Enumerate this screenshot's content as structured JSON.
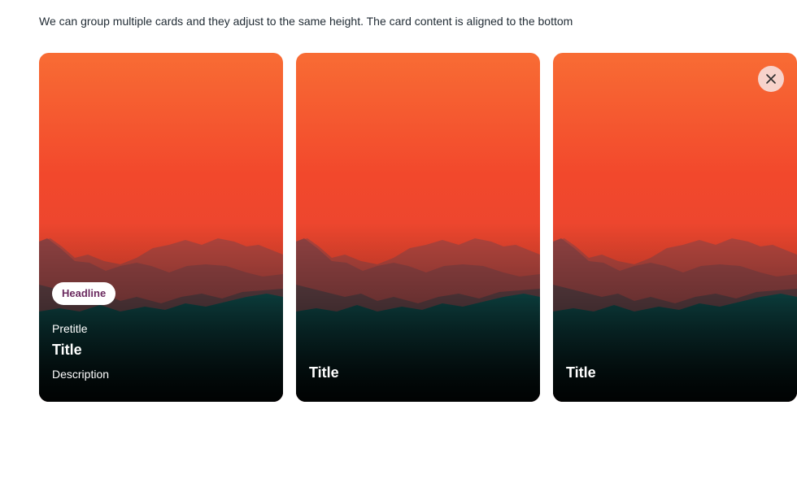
{
  "intro_text": "We can group multiple cards and they adjust to the same height. The card content is aligned to the bottom",
  "cards": [
    {
      "headline": "Headline",
      "pretitle": "Pretitle",
      "title": "Title",
      "description": "Description"
    },
    {
      "title": "Title"
    },
    {
      "title": "Title",
      "close_icon": "close-icon"
    }
  ],
  "colors": {
    "sky_top": "#f86c34",
    "sky_mid": "#f0472b",
    "mountain_far": "#8c3a3a",
    "mountain_teal": "#0e4a4a",
    "badge_text": "#6b2a5f",
    "close_bg": "#f7d3cb"
  }
}
